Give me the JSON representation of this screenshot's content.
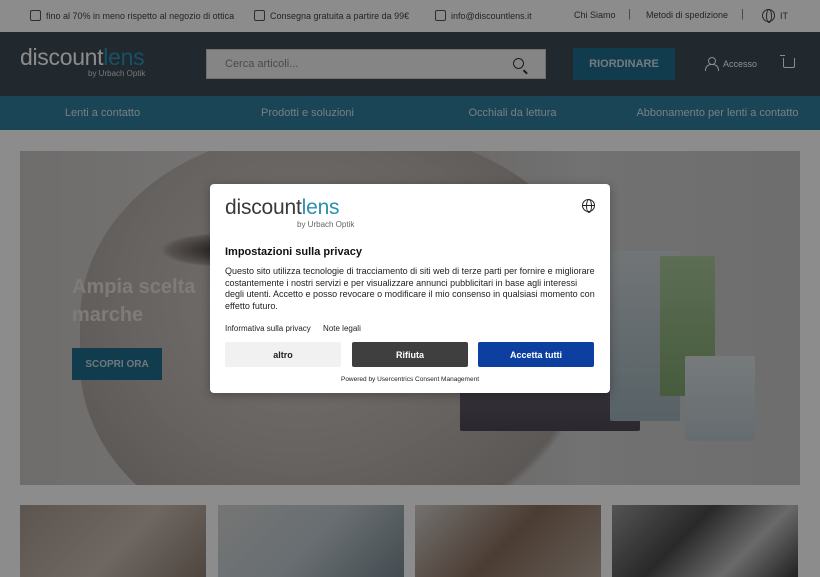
{
  "topbar": {
    "discount_text": "fino al 70% in meno rispetto al negozio di ottica",
    "shipping_text": "Consegna gratuita a partire da 99€",
    "email_text": "info@discountlens.it",
    "about_link": "Chi Siamo",
    "shipping_methods_link": "Metodi di spedizione",
    "language": "IT"
  },
  "header": {
    "logo_main": "discount",
    "logo_accent": "lens",
    "logo_sub": "by Urbach Optik",
    "search_placeholder": "Cerca articoli...",
    "reorder_label": "RIORDINARE",
    "account_label": "Accesso"
  },
  "nav": {
    "items": [
      {
        "label": "Lenti a contatto"
      },
      {
        "label": "Prodotti e soluzioni"
      },
      {
        "label": "Occhiali da lettura"
      },
      {
        "label": "Abbonamento per lenti a contatto"
      }
    ]
  },
  "hero": {
    "headline": "Ampia scelta marche",
    "cta_label": "SCOPRI ORA"
  },
  "consent": {
    "logo_main": "discount",
    "logo_accent": "lens",
    "logo_sub": "by Urbach Optik",
    "title": "Impostazioni sulla privacy",
    "body": "Questo sito utilizza tecnologie di tracciamento di siti web di terze parti per fornire e migliorare costantemente i nostri servizi e per visualizzare annunci pubblicitari in base agli interessi degli utenti. Accetto e posso revocare o modificare il mio consenso in qualsiasi momento con effetto futuro.",
    "privacy_link": "Informativa sulla privacy",
    "legal_link": "Note legali",
    "more_label": "altro",
    "deny_label": "Rifiuta",
    "accept_label": "Accetta tutti",
    "powered_by": "Powered by Usercentrics Consent Management"
  },
  "colors": {
    "header_bg": "#3d4a54",
    "nav_bg": "#2e7f9d",
    "brand_accent": "#2b94b8",
    "accept_button": "#0c3fa0",
    "deny_button": "#3f3f3f"
  },
  "icons": [
    "percent-icon",
    "gift-icon",
    "mail-icon",
    "globe-icon",
    "search-icon",
    "user-icon",
    "cart-icon"
  ]
}
